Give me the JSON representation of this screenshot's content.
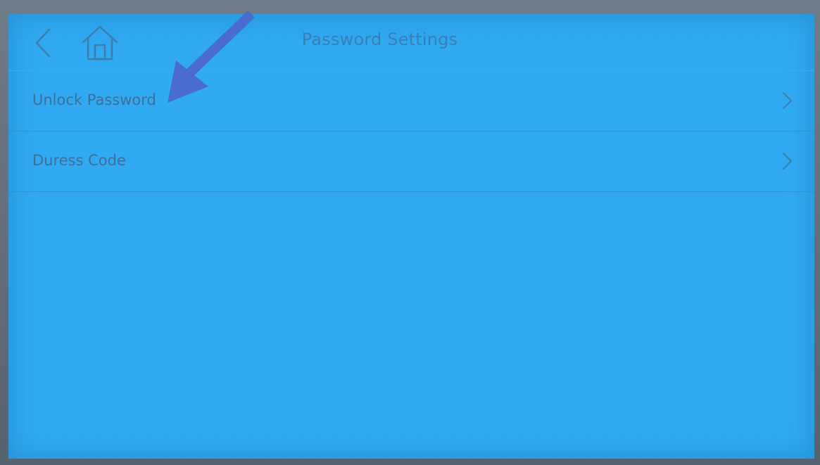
{
  "header": {
    "title": "Password Settings",
    "back_icon": "chevron-left-icon",
    "home_icon": "home-icon"
  },
  "menu": {
    "items": [
      {
        "label": "Unlock Password",
        "icon": "chevron-right-icon"
      },
      {
        "label": "Duress Code",
        "icon": "chevron-right-icon"
      }
    ]
  },
  "colors": {
    "screen_background": "#2ea9f2",
    "text": "#3d6f9a",
    "annotation_arrow": "#4a6bd0"
  }
}
